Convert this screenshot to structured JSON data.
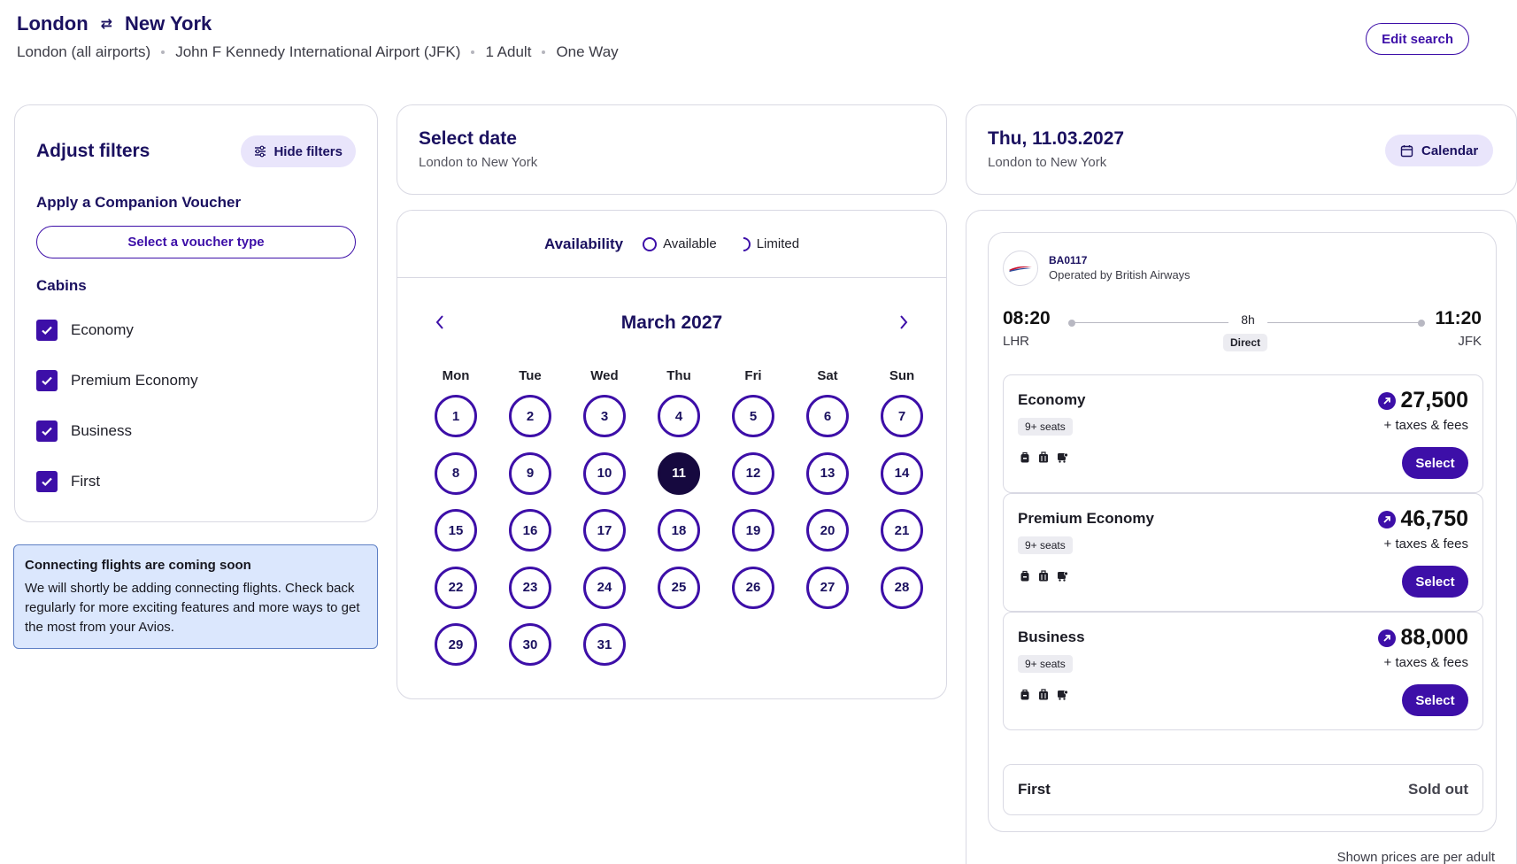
{
  "header": {
    "origin": "London",
    "destination": "New York",
    "details": [
      "London (all airports)",
      "John F Kennedy International Airport (JFK)",
      "1 Adult",
      "One Way"
    ],
    "edit_label": "Edit search"
  },
  "filters": {
    "title": "Adjust filters",
    "hide_label": "Hide filters",
    "voucher_heading": "Apply a Companion Voucher",
    "voucher_button": "Select a voucher type",
    "cabins_heading": "Cabins",
    "cabins": [
      {
        "label": "Economy",
        "checked": true
      },
      {
        "label": "Premium Economy",
        "checked": true
      },
      {
        "label": "Business",
        "checked": true
      },
      {
        "label": "First",
        "checked": true
      }
    ]
  },
  "notice": {
    "title": "Connecting flights are coming soon",
    "body": "We will shortly be adding connecting flights. Check back regularly for more exciting features and more ways to get the most from your Avios."
  },
  "select_date": {
    "title": "Select date",
    "subtitle": "London to New York"
  },
  "calendar": {
    "availability_label": "Availability",
    "legend_available": "Available",
    "legend_limited": "Limited",
    "month": "March 2027",
    "weekdays": [
      "Mon",
      "Tue",
      "Wed",
      "Thu",
      "Fri",
      "Sat",
      "Sun"
    ],
    "days": [
      "1",
      "2",
      "3",
      "4",
      "5",
      "6",
      "7",
      "8",
      "9",
      "10",
      "11",
      "12",
      "13",
      "14",
      "15",
      "16",
      "17",
      "18",
      "19",
      "20",
      "21",
      "22",
      "23",
      "24",
      "25",
      "26",
      "27",
      "28",
      "29",
      "30",
      "31"
    ],
    "selected_day": "11",
    "colors": {
      "available": "#3d0fa8",
      "selected": "#16093f"
    }
  },
  "date_header": {
    "title": "Thu, 11.03.2027",
    "subtitle": "London to New York",
    "calendar_label": "Calendar"
  },
  "flight": {
    "number": "BA0117",
    "operator": "Operated by British Airways",
    "dep_time": "08:20",
    "dep_airport": "LHR",
    "arr_time": "11:20",
    "arr_airport": "JFK",
    "duration": "8h",
    "stops": "Direct",
    "cabins": [
      {
        "name": "Economy",
        "seats": "9+ seats",
        "price": "27,500",
        "taxes": "+ taxes & fees",
        "select": "Select"
      },
      {
        "name": "Premium Economy",
        "seats": "9+ seats",
        "price": "46,750",
        "taxes": "+ taxes & fees",
        "select": "Select"
      },
      {
        "name": "Business",
        "seats": "9+ seats",
        "price": "88,000",
        "taxes": "+ taxes & fees",
        "select": "Select"
      }
    ],
    "first": {
      "name": "First",
      "status": "Sold out"
    }
  },
  "footer_note": "Shown prices are per adult"
}
